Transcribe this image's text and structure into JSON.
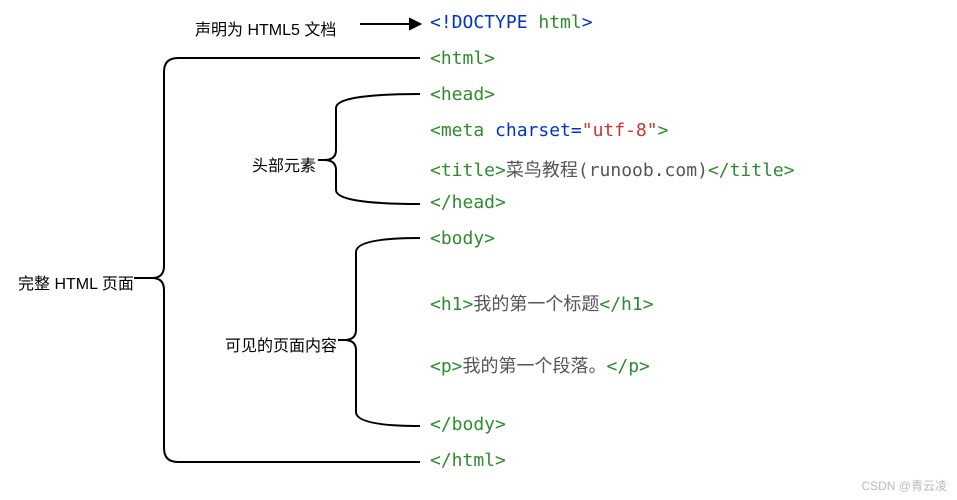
{
  "labels": {
    "root": "完整 HTML 页面",
    "doctype": "声明为 HTML5 文档",
    "head": "头部元素",
    "body": "可见的页面内容"
  },
  "code": {
    "l1_kw": "<!DOCTYPE ",
    "l1_tag": "html",
    "l1_end": ">",
    "l2": "<html>",
    "l3": "<head>",
    "l4_open": "<meta ",
    "l4_attr": "charset=",
    "l4_str": "\"utf-8\"",
    "l4_close": ">",
    "l5_open": "<title>",
    "l5_txt": "菜鸟教程(runoob.com)",
    "l5_close": "</title>",
    "l6": "</head>",
    "l7": "<body>",
    "l8_open": "<h1>",
    "l8_txt": "我的第一个标题",
    "l8_close": "</h1>",
    "l9_open": "<p>",
    "l9_txt": "我的第一个段落。",
    "l9_close": "</p>",
    "l10": "</body>",
    "l11": "</html>"
  },
  "watermark": "CSDN @青云凌"
}
